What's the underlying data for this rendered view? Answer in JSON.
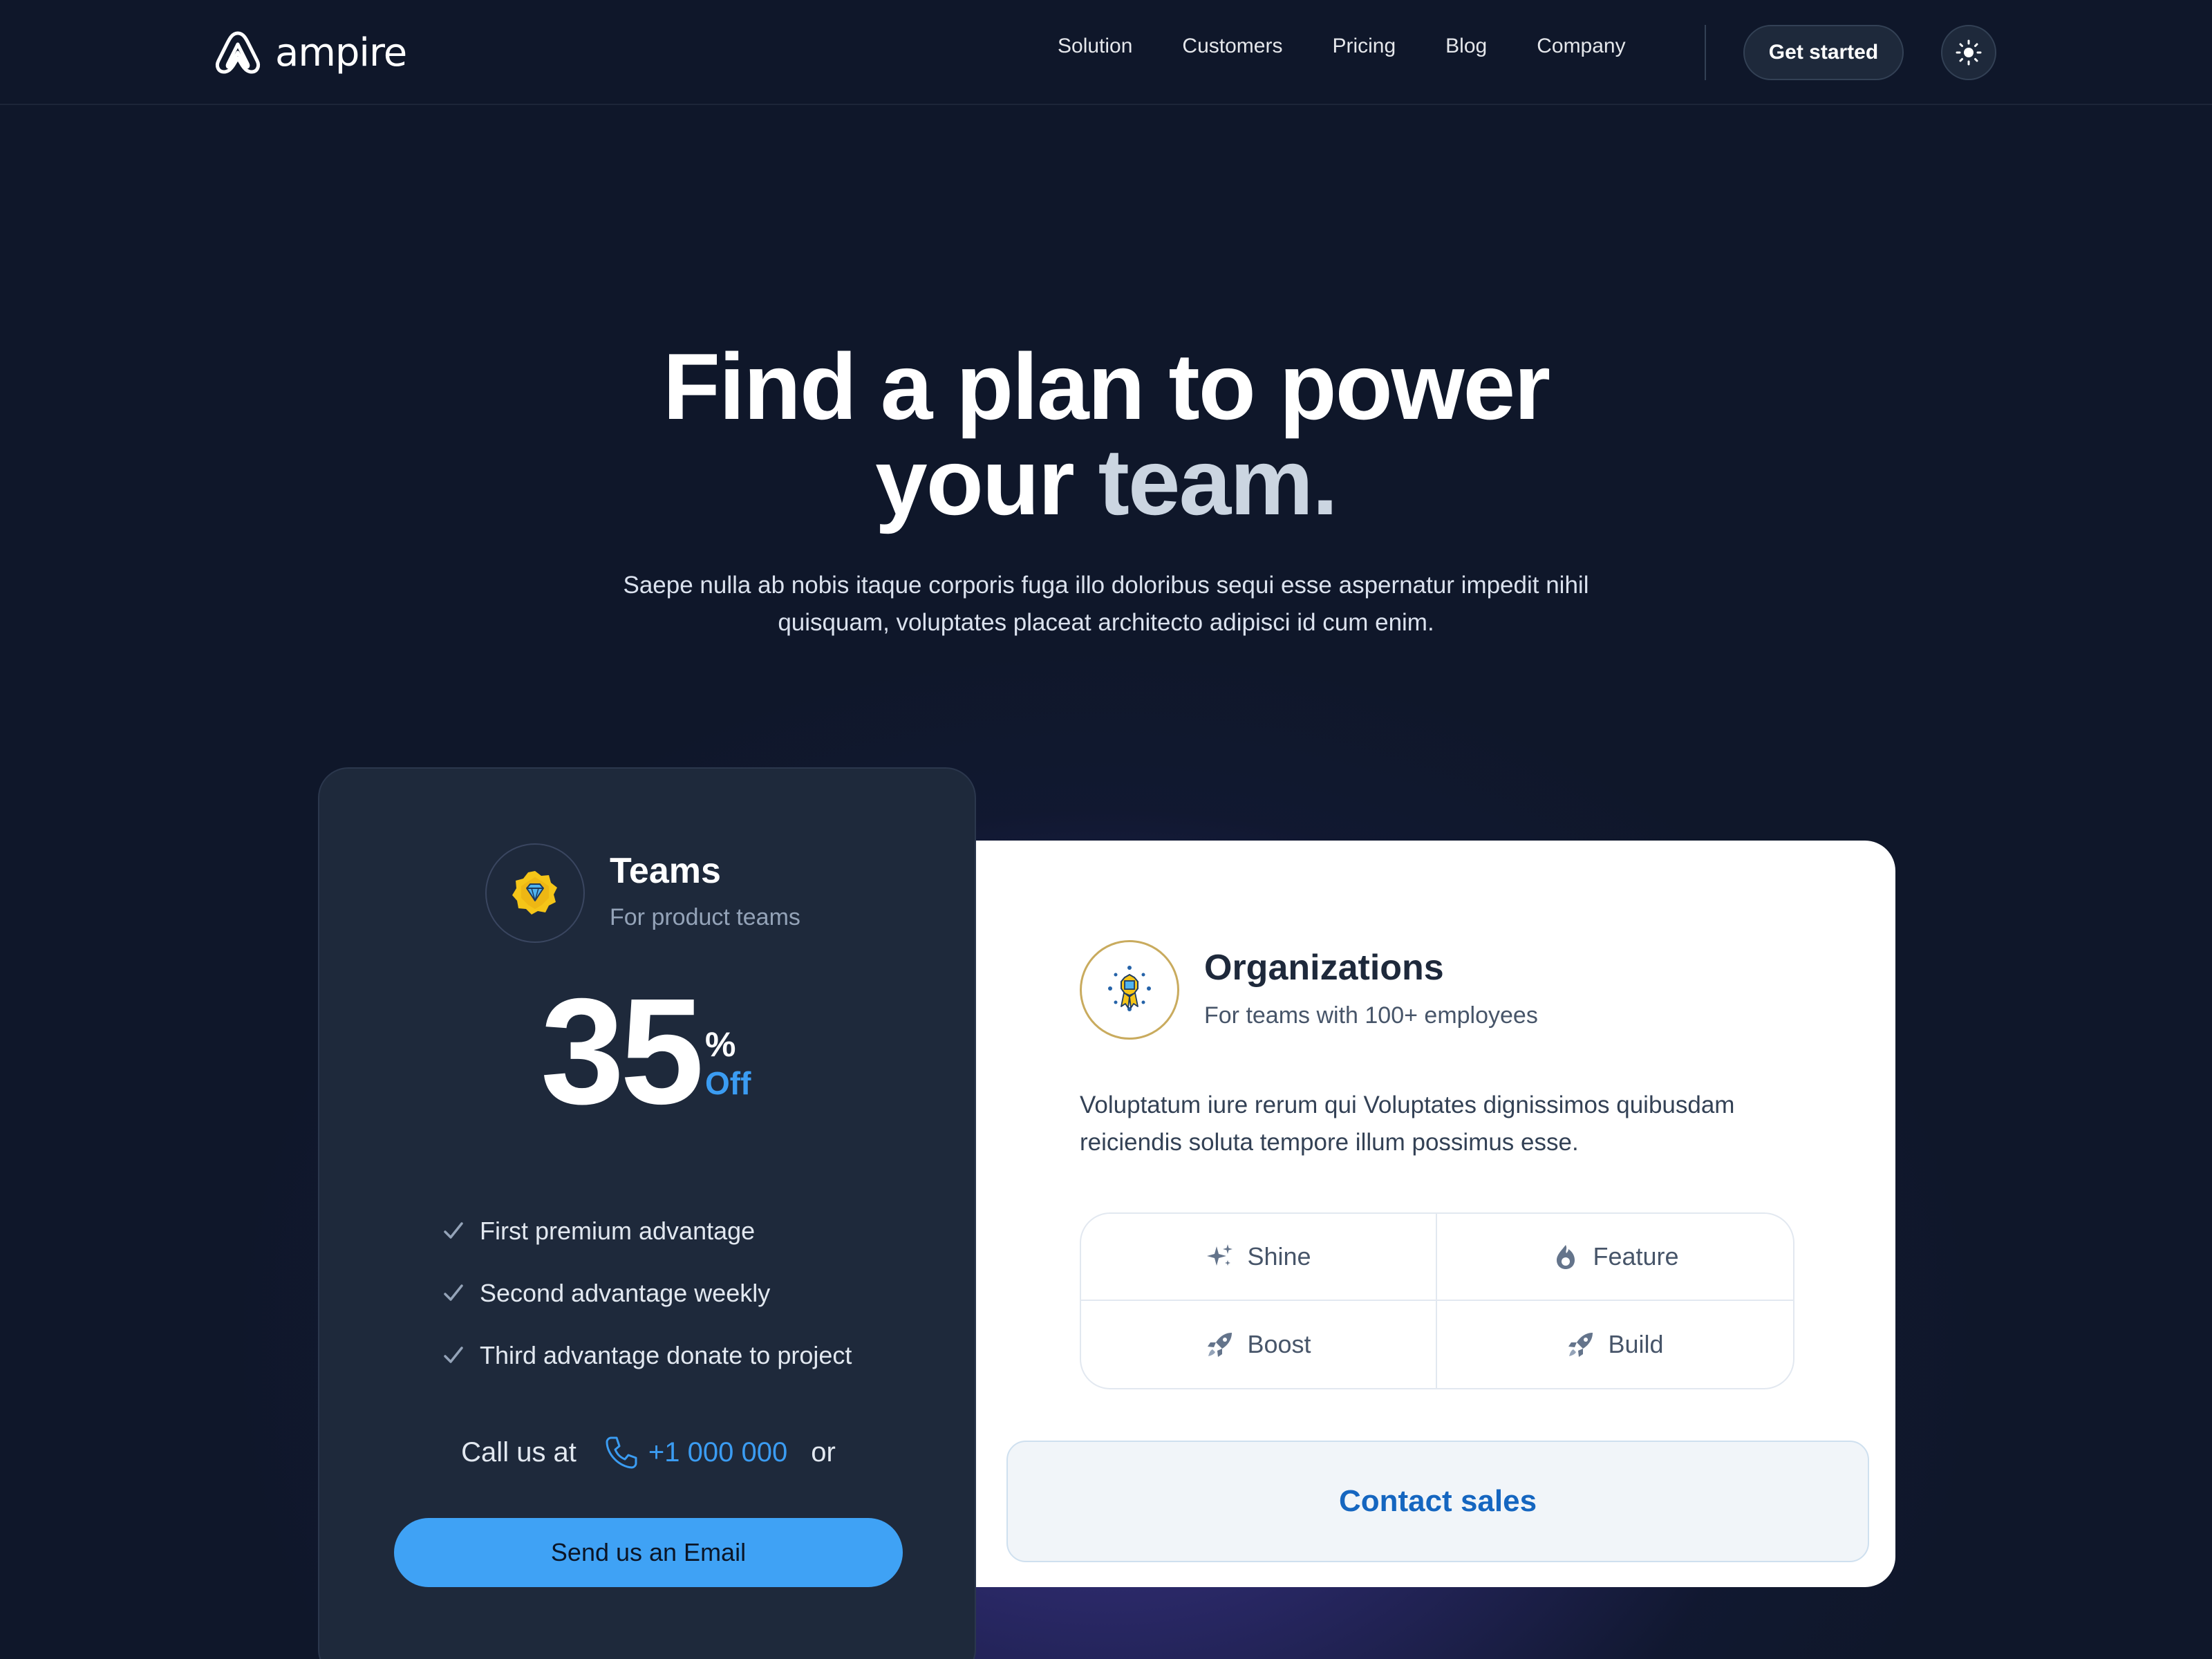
{
  "brand": {
    "name": "ampire",
    "logo_icon": "ampire-logo-icon"
  },
  "nav": {
    "links": [
      "Solution",
      "Customers",
      "Pricing",
      "Blog",
      "Company"
    ],
    "cta_label": "Get started",
    "theme_toggle_icon": "sun-icon"
  },
  "hero": {
    "title_line1": "Find a plan to power",
    "title_line2_a": "your",
    "title_line2_b": "team.",
    "subtitle": "Saepe nulla ab nobis itaque corporis fuga illo doloribus sequi esse aspernatur impedit nihil quisquam, voluptates placeat architecto adipisci id cum enim."
  },
  "teams_plan": {
    "icon": "diamond-badge-icon",
    "name": "Teams",
    "description": "For product teams",
    "discount_value": "35",
    "discount_percent": "%",
    "discount_off": "Off",
    "advantages": [
      "First premium advantage",
      "Second advantage weekly",
      "Third advantage donate to project"
    ],
    "call_label": "Call us at",
    "phone": "+1 000 000",
    "call_or": "or",
    "email_button": "Send us an Email"
  },
  "org_plan": {
    "icon": "award-medal-icon",
    "name": "Organizations",
    "description": "For teams with 100+ employees",
    "text": "Voluptatum iure rerum qui Voluptates dignissimos quibusdam reiciendis soluta tempore illum possimus esse.",
    "features": [
      {
        "label": "Shine",
        "icon": "sparkles-icon"
      },
      {
        "label": "Feature",
        "icon": "flame-icon"
      },
      {
        "label": "Boost",
        "icon": "rocket-icon"
      },
      {
        "label": "Build",
        "icon": "rocket-icon"
      }
    ],
    "contact_button": "Contact sales"
  },
  "colors": {
    "background": "#0f172a",
    "accent_blue": "#3fa2f5",
    "link_blue": "#1566c0",
    "card_dark": "#1e293b"
  }
}
